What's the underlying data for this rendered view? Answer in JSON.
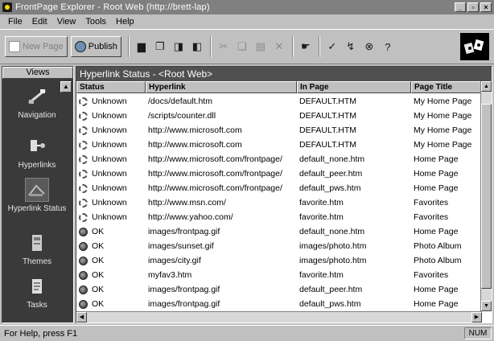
{
  "window": {
    "title": "FrontPage Explorer - Root Web (http://brett-lap)",
    "min": "_",
    "max": "▫",
    "close": "×"
  },
  "menu": [
    "File",
    "Edit",
    "View",
    "Tools",
    "Help"
  ],
  "toolbar": {
    "new_page": "New Page",
    "publish": "Publish",
    "icons": [
      "open-folder-icon",
      "copy-icon",
      "paste-page-icon",
      "import-icon",
      "cut-icon",
      "copy-disabled-icon",
      "paste-disabled-icon",
      "delete-icon",
      "hyperlink-icon",
      "verify-hyperlinks-icon",
      "recalculate-icon",
      "stop-icon",
      "help-icon"
    ]
  },
  "views": {
    "header": "Views",
    "items": [
      {
        "label": "Navigation",
        "icon": "navigation-icon"
      },
      {
        "label": "Hyperlinks",
        "icon": "hyperlinks-icon"
      },
      {
        "label": "Hyperlink Status",
        "icon": "hyperlink-status-icon",
        "selected": true
      },
      {
        "label": "Themes",
        "icon": "themes-icon"
      },
      {
        "label": "Tasks",
        "icon": "tasks-icon"
      }
    ]
  },
  "content": {
    "header": "Hyperlink Status - <Root Web>",
    "columns": [
      "Status",
      "Hyperlink",
      "In Page",
      "Page Title"
    ],
    "rows": [
      {
        "status": "Unknown",
        "kind": "unknown",
        "hyperlink": "/docs/default.htm",
        "page": "DEFAULT.HTM",
        "title": "My Home Page"
      },
      {
        "status": "Unknown",
        "kind": "unknown",
        "hyperlink": "/scripts/counter.dll",
        "page": "DEFAULT.HTM",
        "title": "My Home Page"
      },
      {
        "status": "Unknown",
        "kind": "unknown",
        "hyperlink": "http://www.microsoft.com",
        "page": "DEFAULT.HTM",
        "title": "My Home Page"
      },
      {
        "status": "Unknown",
        "kind": "unknown",
        "hyperlink": "http://www.microsoft.com",
        "page": "DEFAULT.HTM",
        "title": "My Home Page"
      },
      {
        "status": "Unknown",
        "kind": "unknown",
        "hyperlink": "http://www.microsoft.com/frontpage/",
        "page": "default_none.htm",
        "title": "Home Page"
      },
      {
        "status": "Unknown",
        "kind": "unknown",
        "hyperlink": "http://www.microsoft.com/frontpage/",
        "page": "default_peer.htm",
        "title": "Home Page"
      },
      {
        "status": "Unknown",
        "kind": "unknown",
        "hyperlink": "http://www.microsoft.com/frontpage/",
        "page": "default_pws.htm",
        "title": "Home Page"
      },
      {
        "status": "Unknown",
        "kind": "unknown",
        "hyperlink": "http://www.msn.com/",
        "page": "favorite.htm",
        "title": "Favorites"
      },
      {
        "status": "Unknown",
        "kind": "unknown",
        "hyperlink": "http://www.yahoo.com/",
        "page": "favorite.htm",
        "title": "Favorites"
      },
      {
        "status": "OK",
        "kind": "ok",
        "hyperlink": "images/frontpag.gif",
        "page": "default_none.htm",
        "title": "Home Page"
      },
      {
        "status": "OK",
        "kind": "ok",
        "hyperlink": "images/sunset.gif",
        "page": "images/photo.htm",
        "title": "Photo Album"
      },
      {
        "status": "OK",
        "kind": "ok",
        "hyperlink": "images/city.gif",
        "page": "images/photo.htm",
        "title": "Photo Album"
      },
      {
        "status": "OK",
        "kind": "ok",
        "hyperlink": "myfav3.htm",
        "page": "favorite.htm",
        "title": "Favorites"
      },
      {
        "status": "OK",
        "kind": "ok",
        "hyperlink": "images/frontpag.gif",
        "page": "default_peer.htm",
        "title": "Home Page"
      },
      {
        "status": "OK",
        "kind": "ok",
        "hyperlink": "images/frontpag.gif",
        "page": "default_pws.htm",
        "title": "Home Page"
      }
    ]
  },
  "statusbar": {
    "text": "For Help, press F1",
    "num": "NUM"
  }
}
